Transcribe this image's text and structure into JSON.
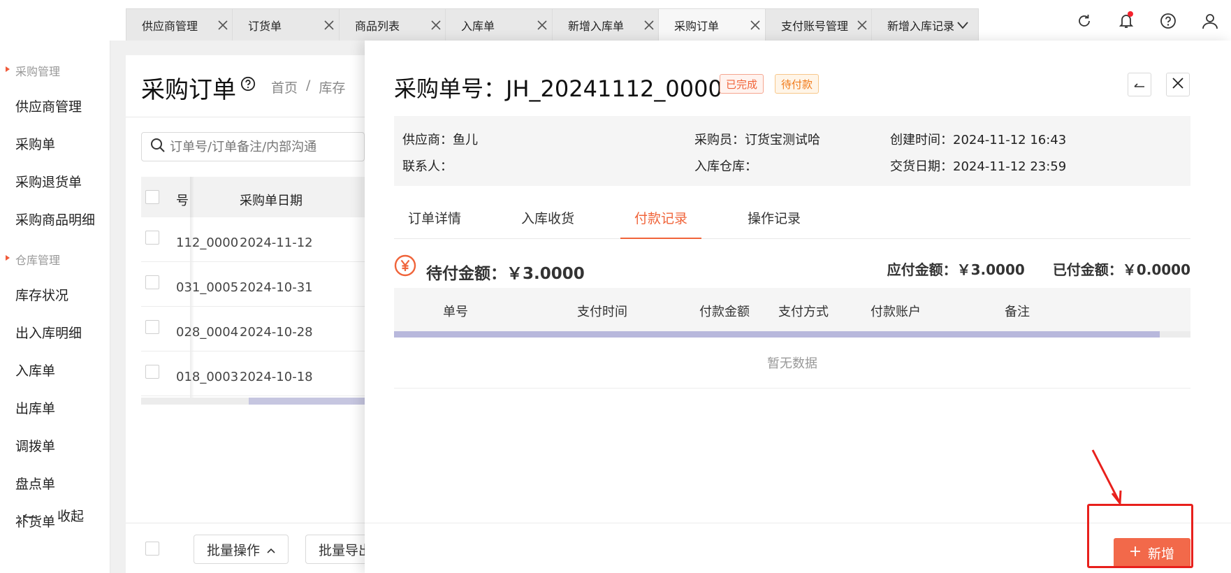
{
  "tabs": [
    {
      "label": "供应商管理"
    },
    {
      "label": "订货单"
    },
    {
      "label": "商品列表"
    },
    {
      "label": "入库单"
    },
    {
      "label": "新增入库单"
    },
    {
      "label": "采购订单"
    },
    {
      "label": "支付账号管理"
    },
    {
      "label": "新增入库记录"
    }
  ],
  "sidebar": {
    "group_purchase": "采购管理",
    "purchase_items": [
      "供应商管理",
      "采购单",
      "采购退货单",
      "采购商品明细"
    ],
    "group_warehouse": "仓库管理",
    "warehouse_items": [
      "库存状况",
      "出入库明细",
      "入库单",
      "出库单",
      "调拨单",
      "盘点单",
      "补货单"
    ],
    "collapse_label": "收起"
  },
  "main": {
    "title": "采购订单",
    "breadcrumb": [
      "首页",
      "/",
      "库存"
    ],
    "search_placeholder": "订单号/订单备注/内部沟通",
    "col_order_no": "号",
    "col_date": "采购单日期",
    "rows": [
      {
        "no": "112_0000",
        "date": "2024-11-12"
      },
      {
        "no": "031_0005",
        "date": "2024-10-31"
      },
      {
        "no": "028_0004",
        "date": "2024-10-28"
      },
      {
        "no": "018_0003",
        "date": "2024-10-18"
      }
    ],
    "batch_op": "批量操作",
    "batch_export": "批量导出"
  },
  "drawer": {
    "title": "采购单号：JH_20241112_0000",
    "tag_done": "已完成",
    "tag_wait": "待付款",
    "supplier": "供应商：鱼儿",
    "contact": "联系人：",
    "buyer": "采购员：订货宝测试哈",
    "warehouse": "入库仓库：",
    "created": "创建时间：2024-11-12 16:43",
    "delivery": "交货日期：2024-11-12 23:59",
    "tabs": [
      "订单详情",
      "入库收货",
      "付款记录",
      "操作记录"
    ],
    "pay_wait": "待付金额：￥3.0000",
    "pay_due": "应付金额：￥3.0000",
    "pay_paid": "已付金额：￥0.0000",
    "columns": [
      "单号",
      "支付时间",
      "付款金额",
      "支付方式",
      "付款账户",
      "备注"
    ],
    "empty": "暂无数据",
    "add_label": "新增"
  }
}
